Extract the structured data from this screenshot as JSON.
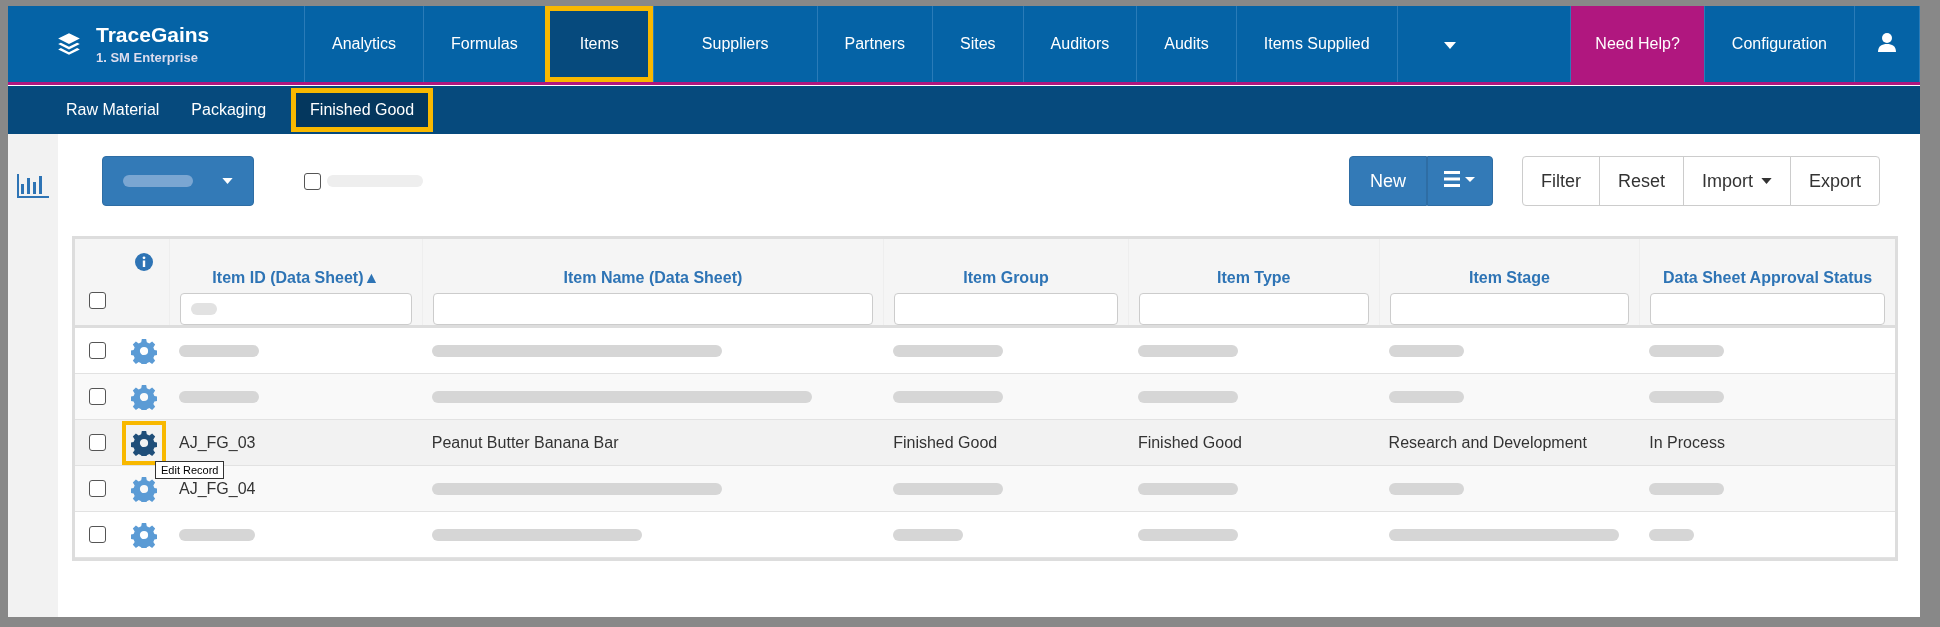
{
  "brand": {
    "name": "TraceGains",
    "subtitle": "1. SM Enterprise"
  },
  "nav": [
    {
      "label": "Analytics",
      "selected": false,
      "highlighted": false
    },
    {
      "label": "Formulas",
      "selected": false,
      "highlighted": false
    },
    {
      "label": "Items",
      "selected": true,
      "highlighted": true
    },
    {
      "label": "Suppliers",
      "selected": false,
      "highlighted": false
    },
    {
      "label": "Partners",
      "selected": false,
      "highlighted": false
    },
    {
      "label": "Sites",
      "selected": false,
      "highlighted": false
    },
    {
      "label": "Auditors",
      "selected": false,
      "highlighted": false
    },
    {
      "label": "Audits",
      "selected": false,
      "highlighted": false
    },
    {
      "label": "Items Supplied",
      "selected": false,
      "highlighted": false
    }
  ],
  "help": "Need Help?",
  "configuration": "Configuration",
  "subnav": [
    {
      "label": "Raw Material",
      "selected": false,
      "highlighted": false
    },
    {
      "label": "Packaging",
      "selected": false,
      "highlighted": false
    },
    {
      "label": "Finished Good",
      "selected": true,
      "highlighted": true
    }
  ],
  "toolbar": {
    "show_inactive": {
      "checked": false
    },
    "new": "New",
    "buttons": [
      {
        "label": "Filter",
        "kind": "plain"
      },
      {
        "label": "Reset",
        "kind": "plain"
      },
      {
        "label": "Import",
        "kind": "dropdown"
      },
      {
        "label": "Export",
        "kind": "plain"
      }
    ]
  },
  "table": {
    "select_all": {
      "checked": false
    },
    "columns": [
      {
        "label": "Item ID (Data Sheet)",
        "sort": "▲"
      },
      {
        "label": "Item Name (Data Sheet)"
      },
      {
        "label": "Item Group"
      },
      {
        "label": "Item Type"
      },
      {
        "label": "Item Stage"
      },
      {
        "label": "Data Sheet Approval Status"
      }
    ],
    "rows": [
      {
        "checked": false,
        "highlighted": false,
        "cells": [
          null,
          null,
          null,
          null,
          null,
          null
        ]
      },
      {
        "checked": false,
        "highlighted": false,
        "cells": [
          null,
          null,
          null,
          null,
          null,
          null
        ]
      },
      {
        "checked": false,
        "highlighted": true,
        "tooltip": "Edit Record",
        "cells": [
          "AJ_FG_03",
          "Peanut Butter Banana Bar",
          "Finished Good",
          "Finished Good",
          "Research and Development",
          "In Process"
        ]
      },
      {
        "checked": false,
        "highlighted": false,
        "cells": [
          "AJ_FG_04",
          null,
          null,
          null,
          null,
          null
        ]
      },
      {
        "checked": false,
        "highlighted": false,
        "cells": [
          null,
          null,
          null,
          null,
          null,
          null
        ]
      }
    ]
  }
}
